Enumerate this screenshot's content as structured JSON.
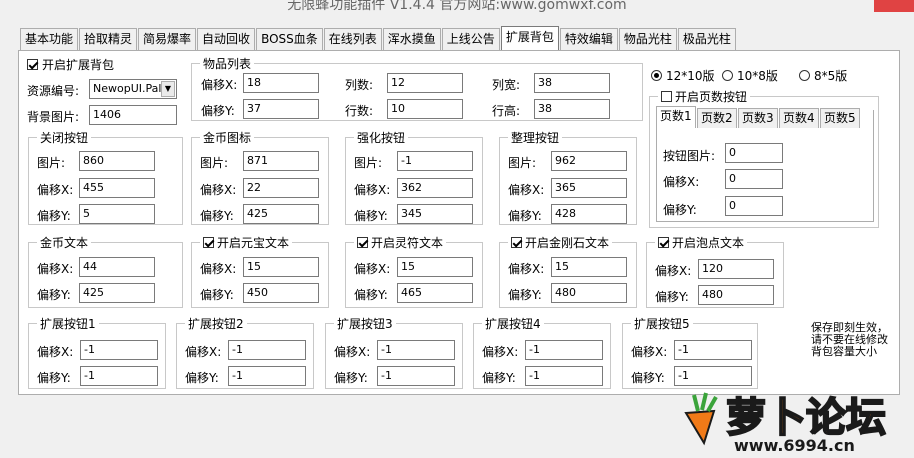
{
  "window": {
    "title": "无限蜂功能插件 V1.4.4  官方网站:www.gomwxf.com"
  },
  "tabs": [
    "基本功能",
    "拾取精灵",
    "简易爆率",
    "自动回收",
    "BOSS血条",
    "在线列表",
    "浑水摸鱼",
    "上线公告",
    "扩展背包",
    "特效编辑",
    "物品光柱",
    "极品光柱"
  ],
  "active_tab": "扩展背包",
  "enable_bag": {
    "label": "开启扩展背包",
    "checked": true
  },
  "resource": {
    "label": "资源编号:",
    "value": "NewopUI.Pal"
  },
  "bg_image": {
    "label": "背景图片:",
    "value": "1406"
  },
  "item_list": {
    "title": "物品列表",
    "offset_x_label": "偏移X:",
    "offset_x": "18",
    "offset_y_label": "偏移Y:",
    "offset_y": "37",
    "cols_label": "列数:",
    "cols": "12",
    "rows_label": "行数:",
    "rows": "10",
    "col_w_label": "列宽:",
    "col_w": "38",
    "row_h_label": "行高:",
    "row_h": "38"
  },
  "versions": {
    "options": [
      "12*10版",
      "10*8版",
      "8*5版"
    ],
    "selected": "12*10版"
  },
  "page_btn": {
    "label": "开启页数按钮",
    "checked": false,
    "tabs": [
      "页数1",
      "页数2",
      "页数3",
      "页数4",
      "页数5"
    ],
    "active": "页数1",
    "img_label": "按钮图片:",
    "img": "0",
    "x_label": "偏移X:",
    "x": "0",
    "y_label": "偏移Y:",
    "y": "0"
  },
  "close_btn": {
    "title": "关闭按钮",
    "img_label": "图片:",
    "img": "860",
    "x_label": "偏移X:",
    "x": "455",
    "y_label": "偏移Y:",
    "y": "5"
  },
  "gold_icon": {
    "title": "金币图标",
    "img_label": "图片:",
    "img": "871",
    "x_label": "偏移X:",
    "x": "22",
    "y_label": "偏移Y:",
    "y": "425"
  },
  "strengthen_btn": {
    "title": "强化按钮",
    "img_label": "图片:",
    "img": "-1",
    "x_label": "偏移X:",
    "x": "362",
    "y_label": "偏移Y:",
    "y": "345"
  },
  "sort_btn": {
    "title": "整理按钮",
    "img_label": "图片:",
    "img": "962",
    "x_label": "偏移X:",
    "x": "365",
    "y_label": "偏移Y:",
    "y": "428"
  },
  "gold_text": {
    "title": "金币文本",
    "x_label": "偏移X:",
    "x": "44",
    "y_label": "偏移Y:",
    "y": "425"
  },
  "yuanbao_text": {
    "title": "开启元宝文本",
    "checked": true,
    "x_label": "偏移X:",
    "x": "15",
    "y_label": "偏移Y:",
    "y": "450"
  },
  "lingfu_text": {
    "title": "开启灵符文本",
    "checked": true,
    "x_label": "偏移X:",
    "x": "15",
    "y_label": "偏移Y:",
    "y": "465"
  },
  "diamond_text": {
    "title": "开启金刚石文本",
    "checked": true,
    "x_label": "偏移X:",
    "x": "15",
    "y_label": "偏移Y:",
    "y": "480"
  },
  "bubble_text": {
    "title": "开启泡点文本",
    "checked": true,
    "x_label": "偏移X:",
    "x": "120",
    "y_label": "偏移Y:",
    "y": "480"
  },
  "ext_btns": [
    {
      "title": "扩展按钮1",
      "x_label": "偏移X:",
      "x": "-1",
      "y_label": "偏移Y:",
      "y": "-1"
    },
    {
      "title": "扩展按钮2",
      "x_label": "偏移X:",
      "x": "-1",
      "y_label": "偏移Y:",
      "y": "-1"
    },
    {
      "title": "扩展按钮3",
      "x_label": "偏移X:",
      "x": "-1",
      "y_label": "偏移Y:",
      "y": "-1"
    },
    {
      "title": "扩展按钮4",
      "x_label": "偏移X:",
      "x": "-1",
      "y_label": "偏移Y:",
      "y": "-1"
    },
    {
      "title": "扩展按钮5",
      "x_label": "偏移X:",
      "x": "-1",
      "y_label": "偏移Y:",
      "y": "-1"
    }
  ],
  "note": [
    "保存即刻生效，",
    "请不要在线修改",
    "背包容量大小"
  ],
  "watermark": {
    "text": "萝卜论坛",
    "url": "www.6994.cn"
  }
}
